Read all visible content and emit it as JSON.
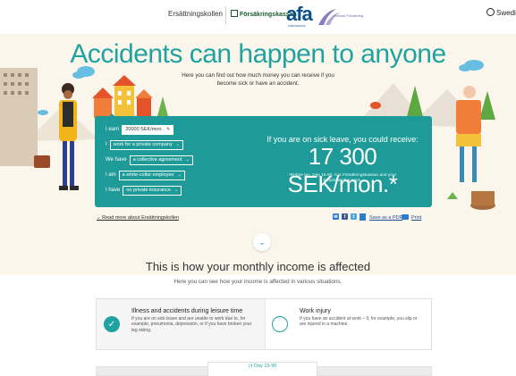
{
  "header": {
    "site_name": "Ersättningskollen",
    "partner1": "Försäkringskassan",
    "partner2": "afa",
    "partner2_sub": "FÖRSÄKRING",
    "partner3": "Svensk Försäkring",
    "language": "Swedish"
  },
  "hero": {
    "title": "Accidents can happen to anyone",
    "subtitle": "Here you can find out how much money you can receive if you become sick or have an accident."
  },
  "form": {
    "row1_prefix": "I earn",
    "row1_value": "20000 SEK/mon.",
    "row2_prefix": "I",
    "row2_value": "work for a private company",
    "row3_prefix": "We have",
    "row3_value": "a collective agreement",
    "row4_prefix": "I am",
    "row4_value": "a white-collar employee",
    "row5_prefix": "I have",
    "row5_value": "no private insurance"
  },
  "result": {
    "caption": "If you are on sick leave, you could receive:",
    "amount": "17 300 SEK/mon.*",
    "fine_print": "*Before tax. Day 15-90. It is Försäkringskassan and your Employer that pays."
  },
  "links": {
    "read_more": "Read more about Ersättningskollen",
    "save_pdf": "Save as a PDF",
    "print": "Print"
  },
  "section": {
    "title": "This is how your monthly income is affected",
    "subtitle": "Here you can see how your income is affected in various situations."
  },
  "options": [
    {
      "title": "Illness and accidents during leisure time",
      "desc": "If you are on sick leave and are unable to work due to, for example, pneumonia, depression, or if you have broken your leg skiing."
    },
    {
      "title": "Work injury",
      "desc": "If you have an accident at work – if, for example, you slip or are injured in a machine."
    }
  ],
  "timeline": {
    "tab_label": "Day 15-90"
  },
  "colors": {
    "accent": "#20a3a0",
    "panel": "#1e9b98",
    "link": "#1d4e8f",
    "hero_bg": "#fbf6ec"
  }
}
